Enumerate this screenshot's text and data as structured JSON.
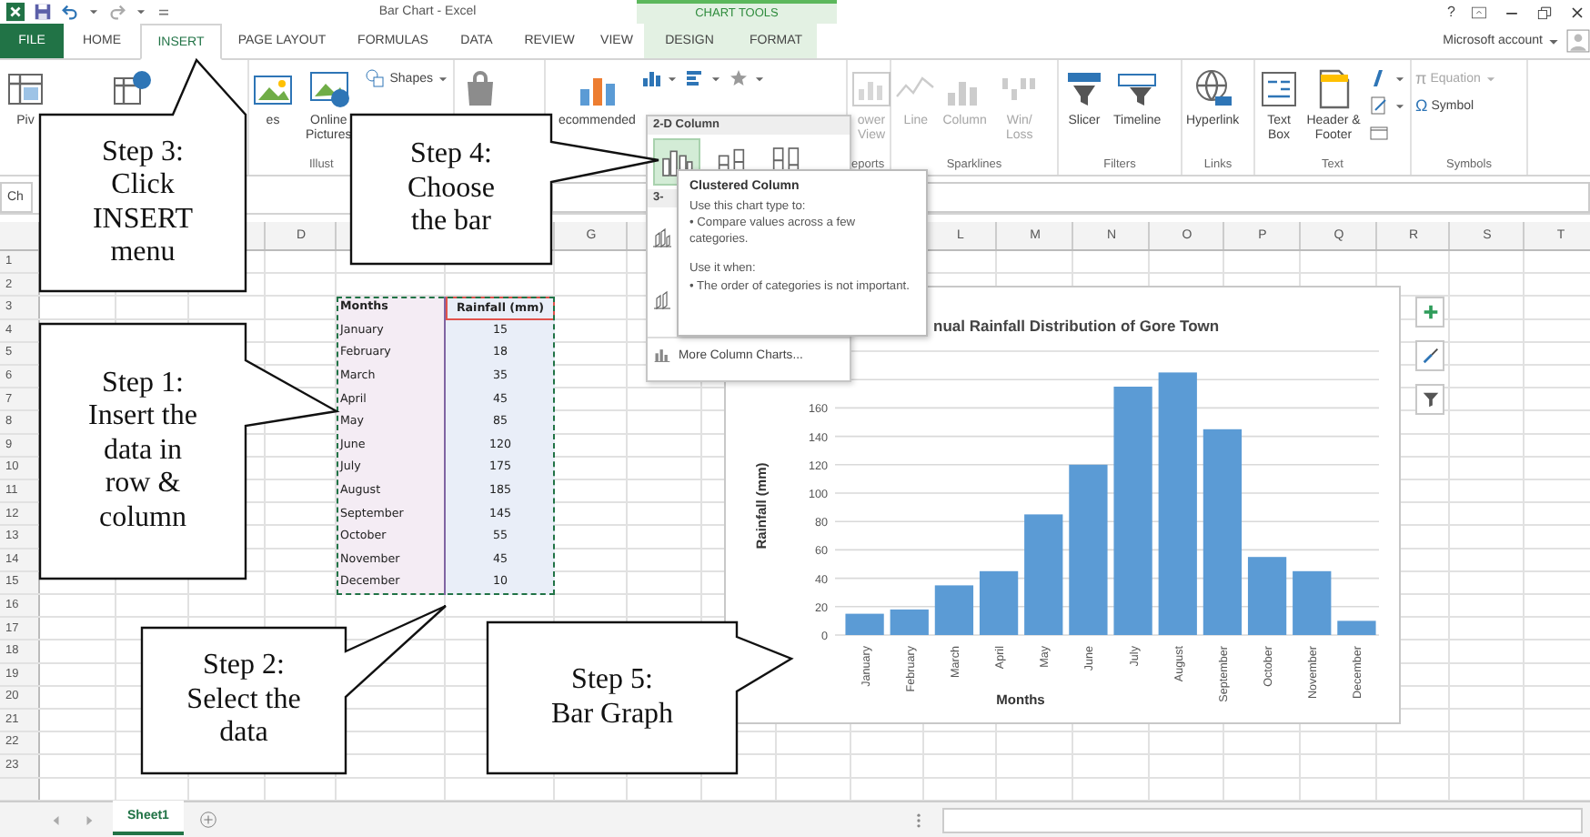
{
  "title_bar": {
    "title": "Bar Chart - Excel",
    "contextual_label": "CHART TOOLS",
    "help": "?"
  },
  "tabs": [
    {
      "label": "FILE",
      "kind": "file",
      "selected": false
    },
    {
      "label": "HOME",
      "kind": "standard",
      "selected": false
    },
    {
      "label": "INSERT",
      "kind": "standard",
      "selected": true
    },
    {
      "label": "PAGE LAYOUT",
      "kind": "standard",
      "selected": false
    },
    {
      "label": "FORMULAS",
      "kind": "standard",
      "selected": false
    },
    {
      "label": "DATA",
      "kind": "standard",
      "selected": false
    },
    {
      "label": "REVIEW",
      "kind": "standard",
      "selected": false
    },
    {
      "label": "VIEW",
      "kind": "standard",
      "selected": false
    },
    {
      "label": "DESIGN",
      "kind": "contextual",
      "selected": false
    },
    {
      "label": "FORMAT",
      "kind": "contextual",
      "selected": false
    }
  ],
  "account": {
    "label": "Microsoft account"
  },
  "ribbon": {
    "groups": [
      {
        "buttons": [
          {
            "label": "Piv",
            "kind": "large",
            "disabled": false
          },
          {
            "kind": "large",
            "disabled": false
          }
        ]
      },
      {
        "label": "Illust",
        "buttons": [
          {
            "label": "es",
            "kind": "large",
            "disabled": false
          },
          {
            "label": "Online Pictures",
            "kind": "large",
            "disabled": false
          },
          {
            "label": "Shapes",
            "kind": "small-menu",
            "disabled": false
          }
        ]
      },
      {
        "buttons": [
          {
            "kind": "large",
            "disabled": false
          }
        ]
      },
      {
        "buttons": [
          {
            "label": "ecommended",
            "kind": "large",
            "disabled": false
          },
          {
            "kind": "small-menu",
            "disabled": false
          },
          {
            "kind": "small-menu",
            "disabled": false
          },
          {
            "kind": "small-menu",
            "disabled": false
          }
        ]
      },
      {
        "label": "eports",
        "buttons": [
          {
            "label": "ower View",
            "kind": "large",
            "disabled": true
          }
        ]
      },
      {
        "label": "Sparklines",
        "buttons": [
          {
            "label": "Line",
            "kind": "large",
            "disabled": true
          },
          {
            "label": "Column",
            "kind": "large",
            "disabled": true
          },
          {
            "label": "Win/ Loss",
            "kind": "large",
            "disabled": true
          }
        ]
      },
      {
        "label": "Filters",
        "buttons": [
          {
            "label": "Slicer",
            "kind": "large",
            "disabled": false
          },
          {
            "label": "Timeline",
            "kind": "large",
            "disabled": false
          }
        ]
      },
      {
        "label": "Links",
        "buttons": [
          {
            "label": "Hyperlink",
            "kind": "large",
            "disabled": false
          }
        ]
      },
      {
        "label": "Text",
        "buttons": [
          {
            "label": "Text Box",
            "kind": "large",
            "disabled": false
          },
          {
            "label": "Header & Footer",
            "kind": "large",
            "disabled": false
          },
          {
            "kind": "small-menu",
            "disabled": false
          },
          {
            "kind": "small-menu",
            "disabled": false
          },
          {
            "kind": "small",
            "disabled": false
          }
        ]
      },
      {
        "label": "Symbols",
        "buttons": [
          {
            "glyph": "π",
            "label": "Equation",
            "kind": "small-menu",
            "disabled": true
          },
          {
            "glyph": "Ω",
            "label": "Symbol",
            "kind": "small",
            "disabled": false
          }
        ]
      }
    ]
  },
  "sheet": {
    "name_box": "Ch",
    "column_headers": [
      "D",
      "G",
      "L",
      "M",
      "N",
      "O",
      "P",
      "Q",
      "R",
      "S",
      "T"
    ],
    "row_headers": [
      "1",
      "2",
      "3",
      "4",
      "5",
      "6",
      "7",
      "8",
      "9",
      "10",
      "11",
      "12",
      "13",
      "14",
      "15",
      "16",
      "17",
      "18",
      "19",
      "20",
      "21",
      "22",
      "23"
    ],
    "table": {
      "columns": [
        "Months",
        "Rainfall (mm)"
      ],
      "rows": [
        [
          "January",
          "15"
        ],
        [
          "February",
          "18"
        ],
        [
          "March",
          "35"
        ],
        [
          "April",
          "45"
        ],
        [
          "May",
          "85"
        ],
        [
          "June",
          "120"
        ],
        [
          "July",
          "175"
        ],
        [
          "August",
          "185"
        ],
        [
          "September",
          "145"
        ],
        [
          "October",
          "55"
        ],
        [
          "November",
          "45"
        ],
        [
          "December",
          "10"
        ]
      ]
    }
  },
  "chart": {
    "chart_data": {
      "type": "bar",
      "title": "nual Rainfall Distribution of Gore Town",
      "xlabel": "Months",
      "ylabel": "Rainfall (mm)",
      "categories": [
        "January",
        "February",
        "March",
        "April",
        "May",
        "June",
        "July",
        "August",
        "September",
        "October",
        "November",
        "December"
      ],
      "series": [
        {
          "color": "#5b9bd5",
          "values": [
            15,
            18,
            35,
            45,
            85,
            120,
            175,
            185,
            145,
            55,
            45,
            10
          ]
        }
      ],
      "ylim": [
        0,
        200
      ],
      "grid": true,
      "yticks": [
        0,
        20,
        40,
        60,
        80,
        100,
        120,
        140,
        160
      ]
    }
  },
  "chart_menu": {
    "sections": [
      {
        "heading": "2-D Column",
        "items": [
          {
            "selected": true
          },
          {
            "selected": false
          },
          {
            "selected": false
          }
        ]
      },
      {
        "heading": "3-",
        "items": [
          {
            "selected": false
          },
          {
            "selected": false
          }
        ]
      }
    ],
    "footer": "More Column Charts..."
  },
  "tooltip": {
    "title": "Clustered Column",
    "lines": [
      "Use this chart type to:",
      "• Compare values across a few categories.",
      "Use it when:",
      "• The order of categories is not important."
    ]
  },
  "callouts": [
    {
      "lines": [
        "Step 3:",
        "Click",
        "INSERT",
        "menu"
      ]
    },
    {
      "lines": [
        "Step 4:",
        "Choose",
        "the bar"
      ]
    },
    {
      "lines": [
        "Step 1:",
        "Insert the",
        "data in",
        "row &",
        "column"
      ]
    },
    {
      "lines": [
        "Step 2:",
        "Select the",
        "data"
      ]
    },
    {
      "lines": [
        "Step 5:",
        "Bar Graph"
      ]
    }
  ],
  "sheet_tabs": [
    {
      "label": "Sheet1",
      "selected": true
    }
  ]
}
